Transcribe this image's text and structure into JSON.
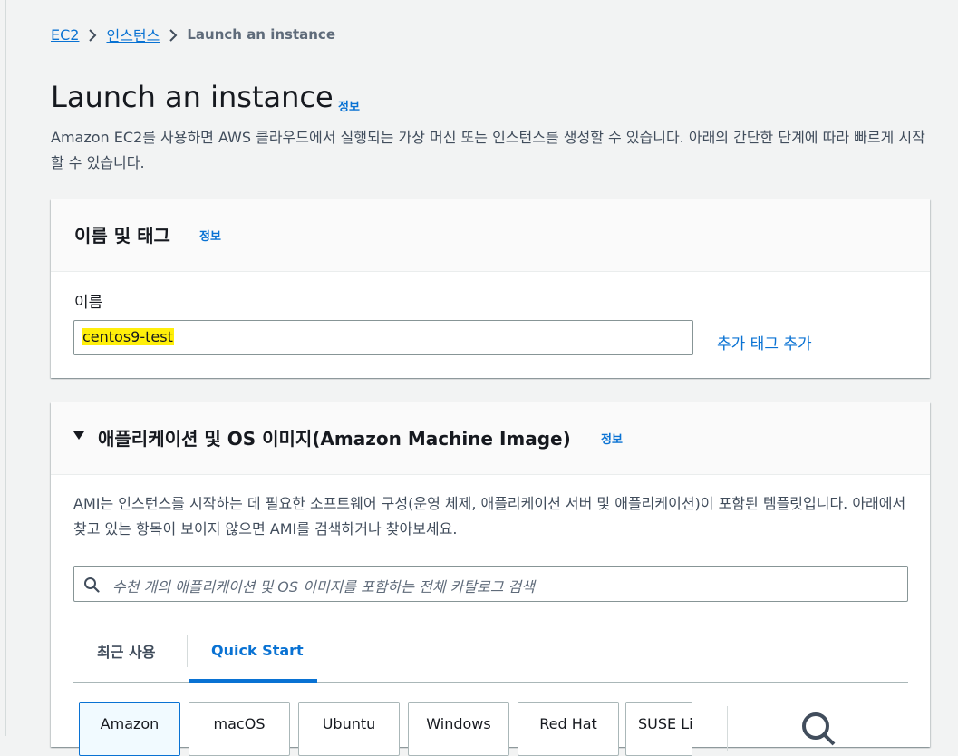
{
  "breadcrumb": {
    "items": [
      "EC2",
      "인스턴스"
    ],
    "current": "Launch an instance"
  },
  "page": {
    "title": "Launch an instance",
    "info_label": "정보",
    "description": "Amazon EC2를 사용하면 AWS 클라우드에서 실행되는 가상 머신 또는 인스턴스를 생성할 수 있습니다. 아래의 간단한 단계에 따라 빠르게 시작할 수 있습니다."
  },
  "name_tags": {
    "title": "이름 및 태그",
    "info_label": "정보",
    "name_label": "이름",
    "name_value": "centos9-test",
    "add_tag_label": "추가 태그 추가"
  },
  "ami": {
    "title": "애플리케이션 및 OS 이미지(Amazon Machine Image)",
    "info_label": "정보",
    "description": "AMI는 인스턴스를 시작하는 데 필요한 소프트웨어 구성(운영 체제, 애플리케이션 서버 및 애플리케이션)이 포함된 템플릿입니다. 아래에서 찾고 있는 항목이 보이지 않으면 AMI를 검색하거나 찾아보세요.",
    "search_placeholder": "수천 개의 애플리케이션 및 OS 이미지를 포함하는 전체 카탈로그 검색",
    "tabs": [
      "최근 사용",
      "Quick Start"
    ],
    "active_tab": "Quick Start",
    "os_options": [
      "Amazon",
      "macOS",
      "Ubuntu",
      "Windows",
      "Red Hat",
      "SUSE Li"
    ],
    "selected_os": "Amazon"
  },
  "colors": {
    "link": "#0972d3",
    "highlight": "#ffef0a",
    "background": "#f2f3f3"
  }
}
